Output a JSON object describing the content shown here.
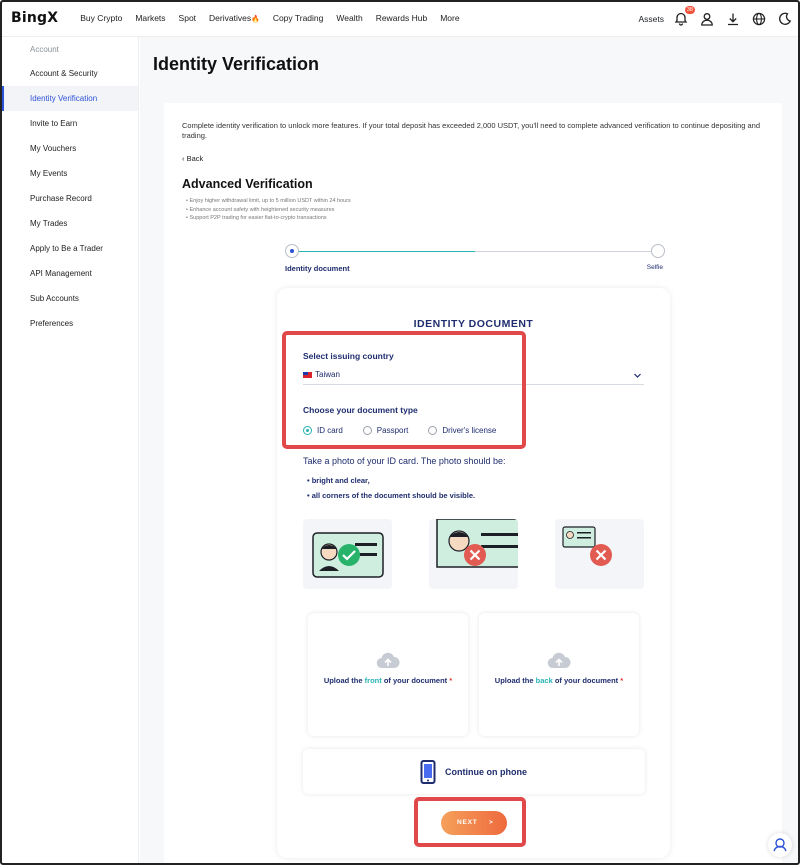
{
  "nav": {
    "logo": "BingX",
    "items": [
      "Buy Crypto",
      "Markets",
      "Spot",
      "Derivatives",
      "Copy Trading",
      "Wealth",
      "Rewards Hub",
      "More"
    ],
    "derivatives_emoji": "🔥",
    "assets": "Assets",
    "notification_count": "38"
  },
  "sidebar": {
    "heading": "Account",
    "items": [
      "Account & Security",
      "Identity Verification",
      "Invite to Earn",
      "My Vouchers",
      "My Events",
      "Purchase Record",
      "My Trades",
      "Apply to Be a Trader",
      "API Management",
      "Sub Accounts",
      "Preferences"
    ],
    "active": "Identity Verification"
  },
  "page": {
    "title": "Identity Verification",
    "intro": "Complete identity verification to unlock more features. If your total deposit has exceeded 2,000 USDT, you'll need to complete advanced verification to continue depositing and trading.",
    "back": "Back",
    "advanced_title": "Advanced Verification",
    "benefits": [
      "Enjoy higher withdrawal limit, up to 5 million USDT within 24 hours",
      "Enhance account safety with heightened security measures",
      "Support P2P trading for easier fiat-to-crypto transactions"
    ]
  },
  "stepper": {
    "step1": "Identity document",
    "step2": "Selfie",
    "progress": 0.5
  },
  "card": {
    "title": "IDENTITY DOCUMENT",
    "country_label": "Select issuing country",
    "country_value": "Taiwan",
    "doc_type_label": "Choose your document type",
    "doc_types": [
      "ID card",
      "Passport",
      "Driver's license"
    ],
    "selected_doc_type": "ID card",
    "instruction": "Take a photo of your ID card. The photo should be:",
    "requirements": [
      "bright and clear,",
      "all corners of the document should be visible."
    ],
    "upload_front": {
      "pre": "Upload the ",
      "highlight": "front",
      "post": " of your document",
      "required": "*"
    },
    "upload_back": {
      "pre": "Upload the ",
      "highlight": "back",
      "post": " of your document",
      "required": "*"
    },
    "phone": "Continue on phone",
    "next": "NEXT",
    "next_arrow": ">"
  },
  "colors": {
    "accent_teal": "#27b3b3",
    "navy": "#1f2d6e",
    "sidebar_active": "#2b53d8",
    "next_gradient_start": "#f5a05a",
    "next_gradient_end": "#ee6a3e",
    "highlight_box": "#e0484a"
  }
}
